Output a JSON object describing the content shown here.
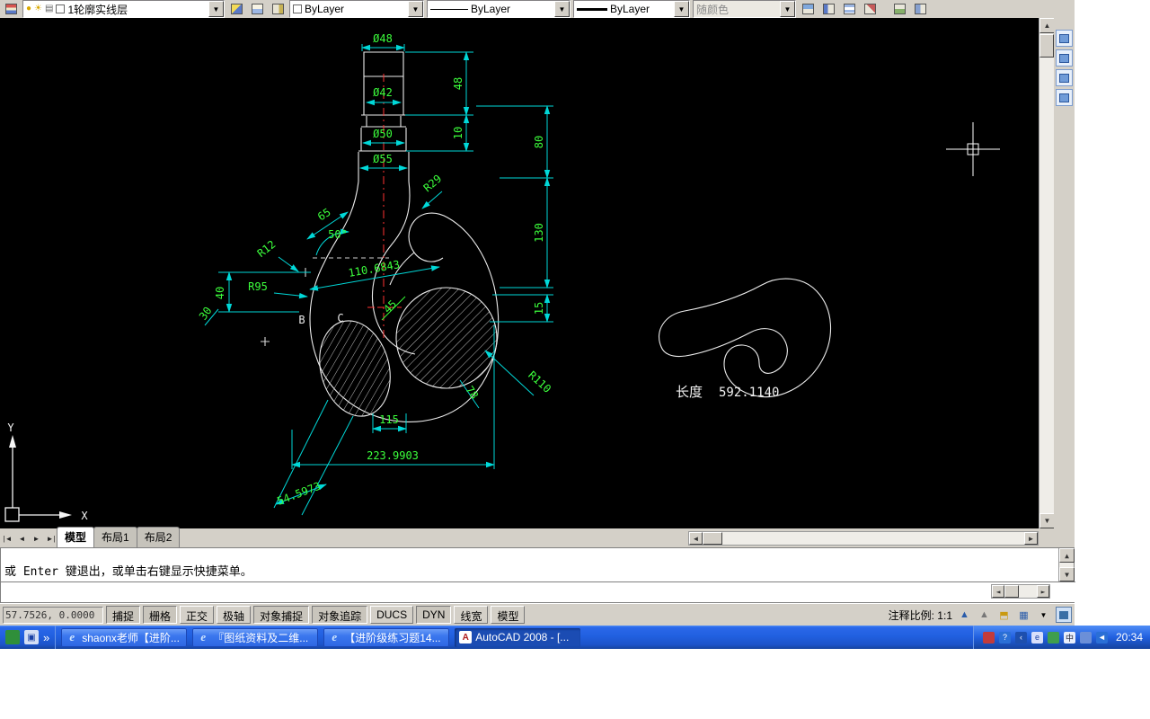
{
  "toolbar": {
    "layer_combo": {
      "value": "1轮廓实线层"
    },
    "color_combo": {
      "value": "ByLayer"
    },
    "linetype_combo": {
      "value": "ByLayer"
    },
    "lineweight_combo": {
      "value": "ByLayer"
    },
    "plotstyle_combo": {
      "value": "随颜色"
    }
  },
  "drawing": {
    "dims": {
      "dia48": "Ø48",
      "dia42": "Ø42",
      "dia50": "Ø50",
      "dia55": "Ø55",
      "len48": "48",
      "len10": "10",
      "len80": "80",
      "len130": "130",
      "len15": "15",
      "r29": "R29",
      "len65": "65",
      "ang50": "50°",
      "r12": "R12",
      "r95": "R95",
      "len40": "40",
      "len30": "30",
      "len110": "110.6843",
      "ang45": "45",
      "r110": "R110",
      "len78": "78",
      "len115": "115",
      "len223": "223.9903",
      "len54": "54.5973"
    },
    "point_b": "B",
    "point_c": "C",
    "length_label": "长度",
    "length_value": "592.1140",
    "ucs_x": "X",
    "ucs_y": "Y"
  },
  "tabs": {
    "model": "模型",
    "layout1": "布局1",
    "layout2": "布局2"
  },
  "command": {
    "history": "或 Enter 键退出，或单击右键显示快捷菜单。",
    "input": ""
  },
  "statusbar": {
    "coords": "57.7526, 0.0000",
    "snap": "捕捉",
    "grid": "栅格",
    "ortho": "正交",
    "polar": "极轴",
    "osnap": "对象捕捉",
    "otrack": "对象追踪",
    "ducs": "DUCS",
    "dyn": "DYN",
    "lwt": "线宽",
    "model": "模型",
    "annotation_scale": "注释比例: 1:1"
  },
  "taskbar": {
    "buttons": [
      {
        "label": "shaonx老师【进阶..."
      },
      {
        "label": "『图纸资料及二维..."
      },
      {
        "label": "【进阶级练习题14..."
      },
      {
        "label": "AutoCAD 2008 - [..."
      }
    ],
    "time": "20:34"
  }
}
